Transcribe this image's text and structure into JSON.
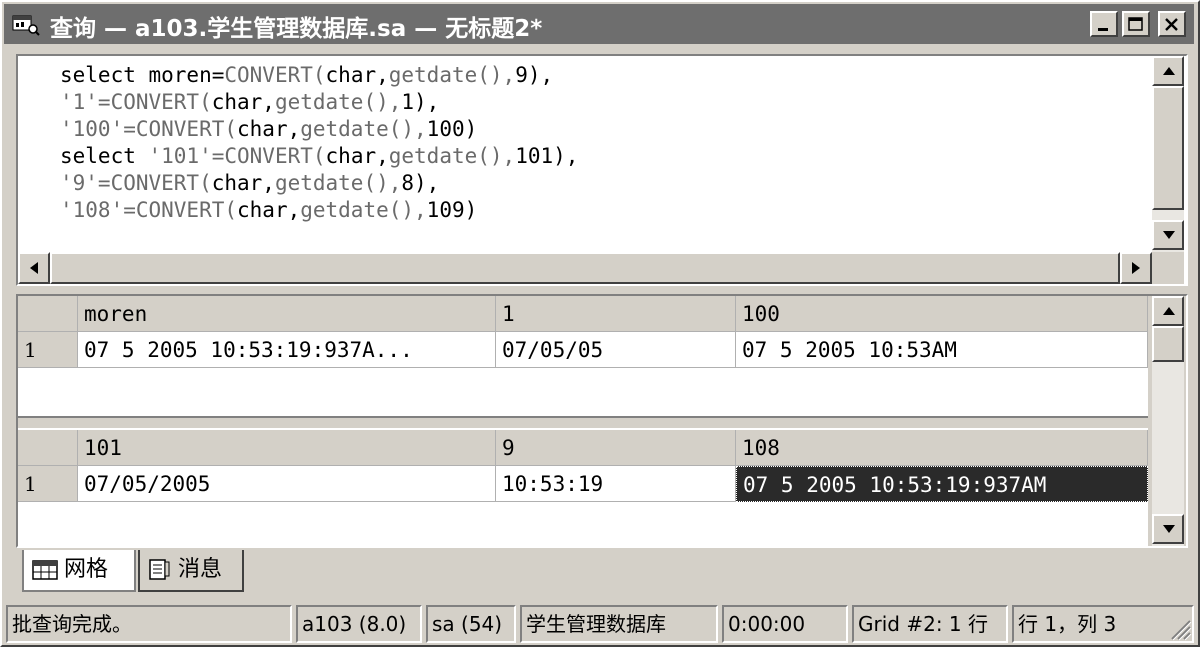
{
  "window": {
    "title": "查询 — a103.学生管理数据库.sa — 无标题2*",
    "icon": "query-window-icon",
    "controls": [
      "minimize",
      "maximize",
      "close"
    ]
  },
  "editor": {
    "lines": [
      [
        {
          "t": "select moren=",
          "c": "k"
        },
        {
          "t": "CONVERT(",
          "c": "g"
        },
        {
          "t": "char,",
          "c": "k"
        },
        {
          "t": "getdate(),",
          "c": "g"
        },
        {
          "t": "9),",
          "c": "k"
        }
      ],
      [
        {
          "t": "'1'=CONVERT(",
          "c": "g"
        },
        {
          "t": "char,",
          "c": "k"
        },
        {
          "t": "getdate(),",
          "c": "g"
        },
        {
          "t": "1),",
          "c": "k"
        }
      ],
      [
        {
          "t": "'100'=CONVERT(",
          "c": "g"
        },
        {
          "t": "char,",
          "c": "k"
        },
        {
          "t": "getdate(),",
          "c": "g"
        },
        {
          "t": "100)",
          "c": "k"
        }
      ],
      [
        {
          "t": "select ",
          "c": "k"
        },
        {
          "t": "'101'=CONVERT(",
          "c": "g"
        },
        {
          "t": "char,",
          "c": "k"
        },
        {
          "t": "getdate(),",
          "c": "g"
        },
        {
          "t": "101),",
          "c": "k"
        }
      ],
      [
        {
          "t": "'9'=CONVERT(",
          "c": "g"
        },
        {
          "t": "char,",
          "c": "k"
        },
        {
          "t": "getdate(),",
          "c": "g"
        },
        {
          "t": "8),",
          "c": "k"
        }
      ],
      [
        {
          "t": "'108'=CONVERT(",
          "c": "g"
        },
        {
          "t": "char,",
          "c": "k"
        },
        {
          "t": "getdate(),",
          "c": "g"
        },
        {
          "t": "109)",
          "c": "k"
        }
      ]
    ]
  },
  "grid1": {
    "columns": [
      "moren",
      "1",
      "100"
    ],
    "rows": [
      {
        "row_label": "1",
        "cells": [
          "07  5 2005 10:53:19:937A...",
          "07/05/05",
          "07  5 2005 10:53AM"
        ]
      }
    ]
  },
  "grid2": {
    "columns": [
      "101",
      "9",
      "108"
    ],
    "rows": [
      {
        "row_label": "1",
        "cells": [
          "07/05/2005",
          "10:53:19",
          "07  5 2005 10:53:19:937AM"
        ]
      }
    ]
  },
  "tabs": {
    "grid_label": "网格",
    "messages_label": "消息"
  },
  "status": {
    "message": "批查询完成。",
    "server": "a103 (8.0)",
    "user": "sa (54)",
    "database": "学生管理数据库",
    "elapsed": "0:00:00",
    "grid_info": "Grid #2: 1 行",
    "position": "行 1，列 3"
  },
  "colors": {
    "titlebar": "#6e6e6e",
    "face": "#d4d0c8",
    "selected_cell": "#2a2a2a"
  }
}
